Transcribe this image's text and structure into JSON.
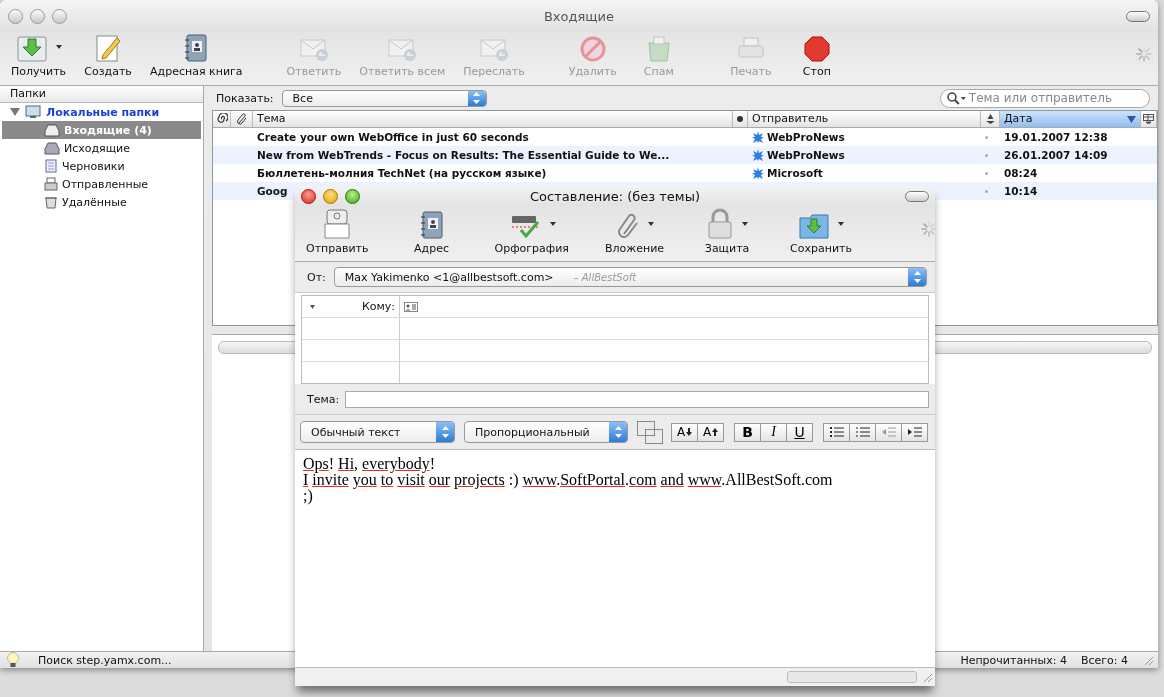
{
  "window": {
    "title": "Входящие"
  },
  "toolbar": [
    {
      "kind": "get",
      "label": "Получить",
      "enabled": true,
      "has_menu": true
    },
    {
      "kind": "create",
      "label": "Создать",
      "enabled": true,
      "has_menu": false
    },
    {
      "kind": "address",
      "label": "Адресная книга",
      "enabled": true,
      "has_menu": false
    },
    {
      "kind": "reply",
      "label": "Ответить",
      "enabled": false,
      "has_menu": false
    },
    {
      "kind": "reply_all",
      "label": "Ответить всем",
      "enabled": false,
      "has_menu": false
    },
    {
      "kind": "forward",
      "label": "Переслать",
      "enabled": false,
      "has_menu": false
    },
    {
      "kind": "delete",
      "label": "Удалить",
      "enabled": false,
      "has_menu": false
    },
    {
      "kind": "spam",
      "label": "Спам",
      "enabled": false,
      "has_menu": false
    },
    {
      "kind": "print",
      "label": "Печать",
      "enabled": false,
      "has_menu": false
    },
    {
      "kind": "stop",
      "label": "Стоп",
      "enabled": true,
      "has_menu": false
    }
  ],
  "sidebar": {
    "header": "Папки",
    "items": [
      {
        "label": "Локальные папки",
        "expanded": true,
        "selected": false,
        "kind": "local",
        "children": [
          {
            "label": "Входящие (4)",
            "selected": true,
            "kind": "inbox"
          },
          {
            "label": "Исходящие",
            "selected": false,
            "kind": "outbox"
          },
          {
            "label": "Черновики",
            "selected": false,
            "kind": "drafts"
          },
          {
            "label": "Отправленные",
            "selected": false,
            "kind": "sent"
          },
          {
            "label": "Удалённые",
            "selected": false,
            "kind": "trash"
          }
        ]
      }
    ]
  },
  "filter": {
    "label": "Показать:",
    "value": "Все"
  },
  "search": {
    "placeholder": "Тема или отправитель"
  },
  "table": {
    "columns": [
      {
        "kind": "thread"
      },
      {
        "kind": "attachment"
      },
      {
        "kind": "text",
        "label": "Тема",
        "sorted": false
      },
      {
        "kind": "read"
      },
      {
        "kind": "text",
        "label": "Отправитель",
        "sorted": false
      },
      {
        "kind": "junk"
      },
      {
        "kind": "text",
        "label": "Дата",
        "sorted": true
      }
    ],
    "rows": [
      {
        "subject": "Create your own WebOffice in just 60 seconds",
        "sender": "WebProNews",
        "date": "19.01.2007 12:38",
        "unread": true
      },
      {
        "subject": "New from WebTrends - Focus on Results: The Essential Guide to We...",
        "sender": "WebProNews",
        "date": "26.01.2007 14:09",
        "unread": true
      },
      {
        "subject": "Бюллетень-молния TechNet (на русском языке)",
        "sender": "Microsoft",
        "date": "08:24",
        "unread": true
      },
      {
        "subject": "Goog",
        "date": "10:14",
        "unread": true
      }
    ]
  },
  "status_bar": {
    "message": "Поиск step.yamx.com...",
    "unread": "Непрочитанных: 4",
    "total": "Всего: 4"
  },
  "compose": {
    "title": "Составление: (без темы)",
    "toolbar": [
      {
        "kind": "send",
        "label": "Отправить",
        "has_menu": false
      },
      {
        "kind": "address",
        "label": "Адрес",
        "has_menu": false
      },
      {
        "kind": "spell",
        "label": "Орфография",
        "has_menu": true
      },
      {
        "kind": "attach",
        "label": "Вложение",
        "has_menu": true
      },
      {
        "kind": "lock",
        "label": "Защита",
        "has_menu": true
      },
      {
        "kind": "save",
        "label": "Сохранить",
        "has_menu": true
      }
    ],
    "from_label": "От:",
    "from_value": "Max Yakimenko <1@allbestsoft.com>",
    "from_identity": "– AllBestSoft",
    "recipients": [
      {
        "label": "Кому:"
      }
    ],
    "subject_label": "Тема:",
    "paragraph_style": "Обычный текст",
    "font": "Пропорциональный",
    "format_buttons": [
      {
        "kind": "smaller",
        "label": "A"
      },
      {
        "kind": "larger",
        "label": "A"
      },
      {
        "kind": "bold",
        "label": "B"
      },
      {
        "kind": "italic",
        "label": "I"
      },
      {
        "kind": "underline",
        "label": "U"
      },
      {
        "kind": "bullets"
      },
      {
        "kind": "numbers"
      },
      {
        "kind": "outdent"
      },
      {
        "kind": "indent"
      }
    ],
    "body": [
      [
        {
          "text": "Ops",
          "misspelled": true
        },
        {
          "text": "! ",
          "misspelled": false
        },
        {
          "text": "Hi",
          "misspelled": true
        },
        {
          "text": ", ",
          "misspelled": false
        },
        {
          "text": "everybody",
          "misspelled": true
        },
        {
          "text": "!",
          "misspelled": false
        }
      ],
      [
        {
          "text": "I ",
          "misspelled": true
        },
        {
          "text": "invite ",
          "misspelled": true
        },
        {
          "text": "you ",
          "misspelled": true
        },
        {
          "text": "to ",
          "misspelled": true
        },
        {
          "text": "visit ",
          "misspelled": true
        },
        {
          "text": "our ",
          "misspelled": true
        },
        {
          "text": "projects",
          "misspelled": true
        },
        {
          "text": " :) ",
          "misspelled": false
        },
        {
          "text": "www",
          "misspelled": true
        },
        {
          "text": ".",
          "misspelled": false
        },
        {
          "text": "SoftPortal",
          "misspelled": true
        },
        {
          "text": ".",
          "misspelled": false
        },
        {
          "text": "com ",
          "misspelled": true
        },
        {
          "text": "and ",
          "misspelled": true
        },
        {
          "text": "www",
          "misspelled": true
        },
        {
          "text": ".AllBestSoft.com",
          "misspelled": false
        }
      ],
      [
        {
          "text": ";)"
        }
      ]
    ]
  }
}
